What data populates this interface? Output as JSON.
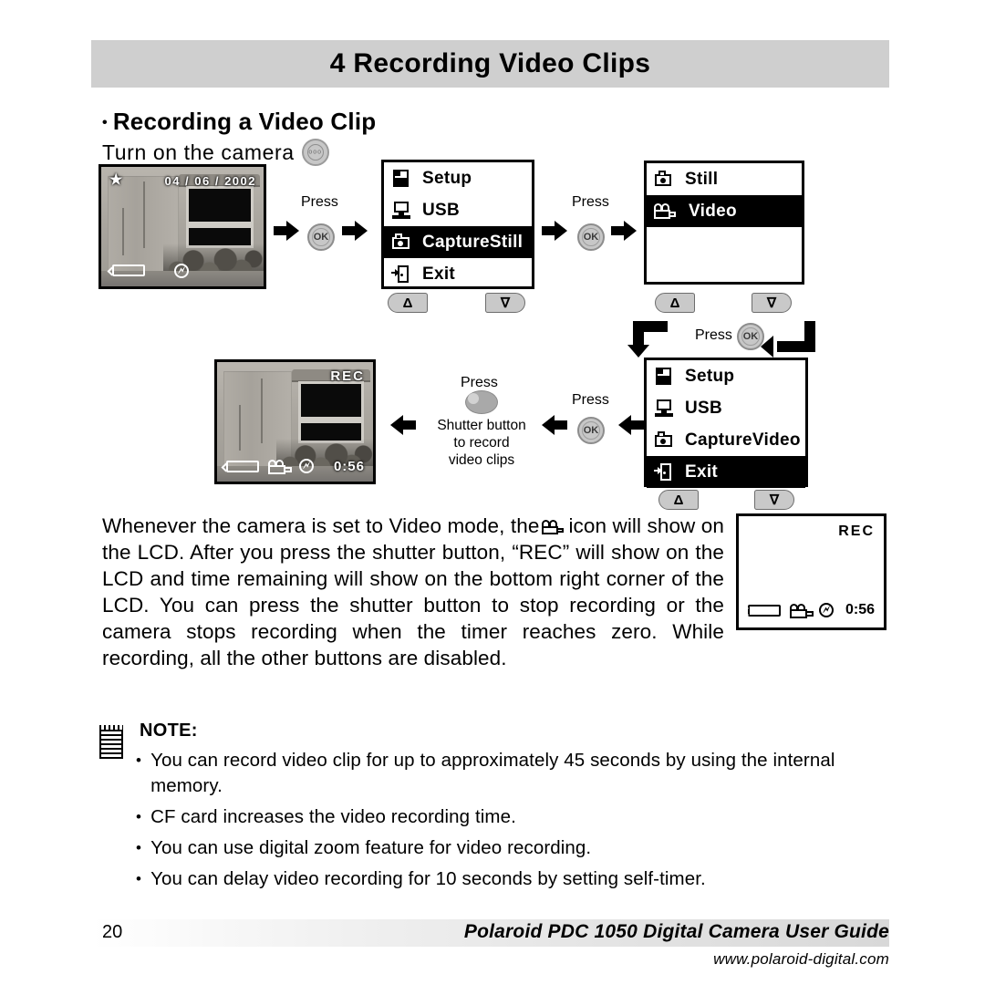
{
  "chapter": {
    "title": "4 Recording Video Clips"
  },
  "section": {
    "bullet": "•",
    "heading": "Recording a Video Clip",
    "turn_on": "Turn on the camera"
  },
  "lcd_preview": {
    "star": "★",
    "date": "04 / 06 / 2002"
  },
  "menu1": {
    "rows": [
      {
        "label": "Setup",
        "value": "",
        "selected": false,
        "icon": "floppy-disk-icon"
      },
      {
        "label": "USB",
        "value": "",
        "selected": false,
        "icon": "monitor-icon"
      },
      {
        "label": "Capture",
        "value": "Still",
        "selected": true,
        "icon": "camera-icon"
      },
      {
        "label": "Exit",
        "value": "",
        "selected": false,
        "icon": "exit-door-icon"
      }
    ],
    "nav": {
      "up": "Δ",
      "down": "∇"
    }
  },
  "menu2": {
    "rows": [
      {
        "label": "Still",
        "value": "",
        "selected": false,
        "icon": "still-camera-icon"
      },
      {
        "label": "Video",
        "value": "",
        "selected": true,
        "icon": "video-camera-icon"
      }
    ],
    "nav": {
      "up": "Δ",
      "down": "∇"
    }
  },
  "menu3": {
    "rows": [
      {
        "label": "Setup",
        "value": "",
        "selected": false,
        "icon": "floppy-disk-icon"
      },
      {
        "label": "USB",
        "value": "",
        "selected": false,
        "icon": "monitor-icon"
      },
      {
        "label": "Capture",
        "value": "Video",
        "selected": false,
        "icon": "camera-icon"
      },
      {
        "label": "Exit",
        "value": "",
        "selected": true,
        "icon": "exit-door-icon"
      }
    ],
    "nav": {
      "up": "Δ",
      "down": "∇"
    }
  },
  "flow": {
    "press1": "Press",
    "press2": "Press",
    "press3": "Press",
    "press4": "Press",
    "press5": "Press",
    "ok_label": "OK",
    "shutter_caption_line1": "Shutter button",
    "shutter_caption_line2": "to record",
    "shutter_caption_line3": "video clips"
  },
  "lcd_recording": {
    "rec": "REC",
    "time": "0:56"
  },
  "lcd_rec_blank": {
    "rec": "REC",
    "time": "0:56"
  },
  "body": {
    "part1": "Whenever the camera is set to Video mode, the",
    "part2": "icon will show on the LCD. After you press the shutter button, “REC” will show on the LCD and time remaining will show on the bottom right corner of the LCD. You can press the shutter button to stop recording or the camera stops recording when the timer reaches zero. While recording, all the other buttons are disabled."
  },
  "note": {
    "title": "NOTE:",
    "bullet": "•",
    "items": [
      "You can record video clip for up to approximately 45 seconds by using the internal memory.",
      "CF card increases the video recording time.",
      "You can use digital zoom feature for video recording.",
      "You can delay video recording for 10 seconds by setting self-timer."
    ]
  },
  "footer": {
    "page_number": "20",
    "guide_title": "Polaroid PDC 1050 Digital Camera User Guide",
    "url": "www.polaroid-digital.com"
  }
}
